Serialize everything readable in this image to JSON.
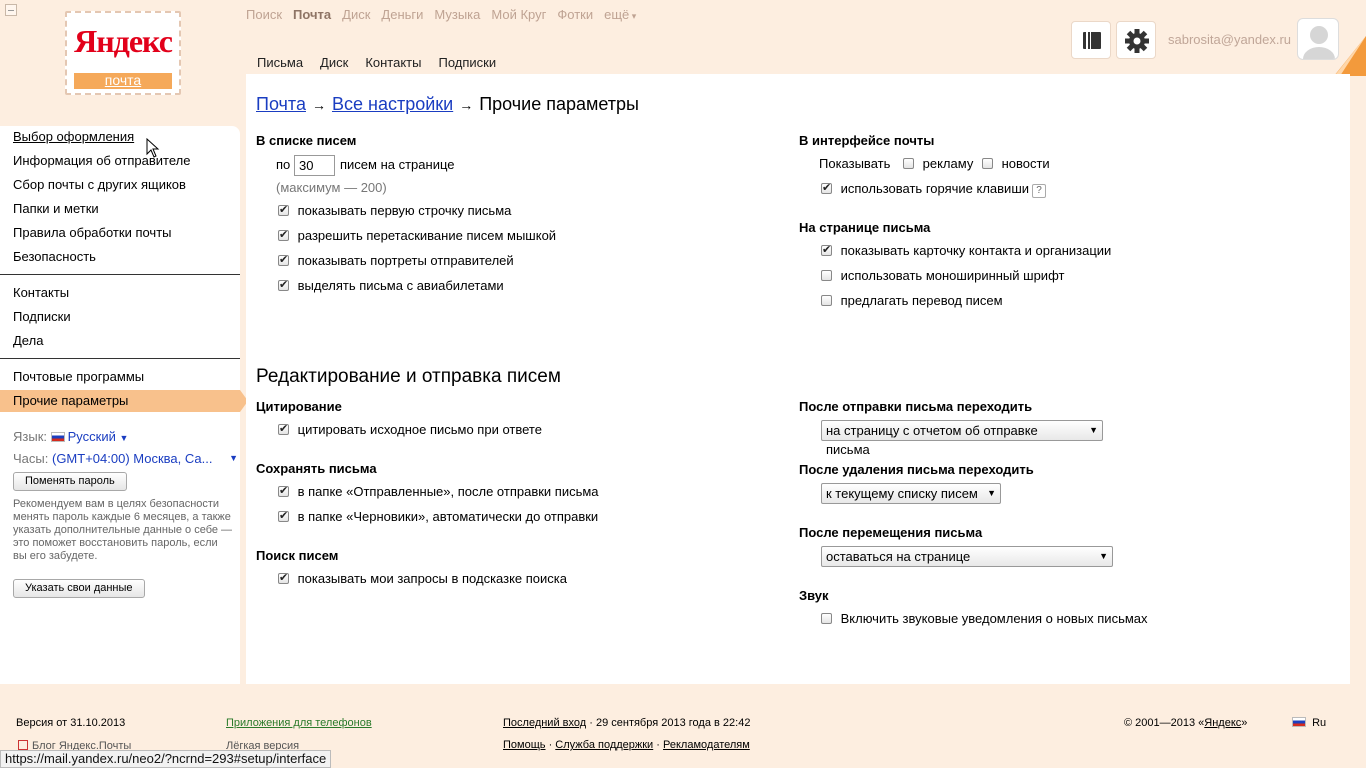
{
  "logo": {
    "brand": "Яндекс",
    "service": "почта"
  },
  "services": [
    {
      "label": "Поиск",
      "active": false
    },
    {
      "label": "Почта",
      "active": true
    },
    {
      "label": "Диск",
      "active": false
    },
    {
      "label": "Деньги",
      "active": false
    },
    {
      "label": "Музыка",
      "active": false
    },
    {
      "label": "Мой Круг",
      "active": false
    },
    {
      "label": "Фотки",
      "active": false
    },
    {
      "label": "ещё",
      "active": false
    }
  ],
  "subnav": [
    "Письма",
    "Диск",
    "Контакты",
    "Подписки"
  ],
  "header": {
    "user_email": "sabrosita@yandex.ru"
  },
  "sidebar": {
    "group1": [
      "Выбор оформления",
      "Информация об отправителе",
      "Сбор почты с других ящиков",
      "Папки и метки",
      "Правила обработки почты",
      "Безопасность"
    ],
    "group2": [
      "Контакты",
      "Подписки",
      "Дела"
    ],
    "group3": [
      "Почтовые программы",
      "Прочие параметры"
    ],
    "language_label": "Язык:",
    "language_value": "Русский",
    "clock_label": "Часы:",
    "clock_value": "(GMT+04:00) Москва, Са...",
    "change_password": "Поменять пароль",
    "note": "Рекомендуем вам в целях безопасности менять пароль каждые 6 месяцев, а также указать дополнительные данные о себе — это поможет восстановить пароль, если вы его забудете.",
    "provide_data": "Указать свои данные"
  },
  "breadcrumb": {
    "root": "Почта",
    "all": "Все настройки",
    "current": "Прочие параметры"
  },
  "list_section": {
    "title": "В списке писем",
    "per_page_prefix": "по",
    "per_page_value": "30",
    "per_page_suffix": "писем на странице",
    "max_note": "(максимум — 200)",
    "options": [
      {
        "label": "показывать первую строчку письма",
        "checked": true
      },
      {
        "label": "разрешить перетаскивание писем мышкой",
        "checked": true
      },
      {
        "label": "показывать портреты отправителей",
        "checked": true
      },
      {
        "label": "выделять письма с авиабилетами",
        "checked": true
      }
    ]
  },
  "interface_section": {
    "title": "В интерфейсе почты",
    "show_label": "Показывать",
    "ads": {
      "label": "рекламу",
      "checked": false
    },
    "news": {
      "label": "новости",
      "checked": false
    },
    "hotkeys": {
      "label": "использовать горячие клавиши",
      "checked": true
    },
    "help": "?"
  },
  "letter_page_section": {
    "title": "На странице письма",
    "options": [
      {
        "label": "показывать карточку контакта и организации",
        "checked": true
      },
      {
        "label": "использовать моноширинный шрифт",
        "checked": false
      },
      {
        "label": "предлагать перевод писем",
        "checked": false
      }
    ]
  },
  "edit_section": {
    "title": "Редактирование и отправка писем",
    "quote_title": "Цитирование",
    "quote_option": {
      "label": "цитировать исходное письмо при ответе",
      "checked": true
    },
    "save_title": "Сохранять письма",
    "save_options": [
      {
        "label": "в папке «Отправленные», после отправки письма",
        "checked": true
      },
      {
        "label": "в папке «Черновики», автоматически до отправки",
        "checked": true
      }
    ],
    "search_title": "Поиск писем",
    "search_option": {
      "label": "показывать мои запросы в подсказке поиска",
      "checked": true
    },
    "after_send_title": "После отправки письма переходить",
    "after_send_value": "на страницу с отчетом об отправке письма",
    "after_delete_title": "После удаления письма переходить",
    "after_delete_value": "к текущему списку писем",
    "after_move_title": "После перемещения письма",
    "after_move_value": "оставаться на странице",
    "sound_title": "Звук",
    "sound_option": {
      "label": "Включить звуковые уведомления о новых письмах",
      "checked": false
    }
  },
  "footer": {
    "version": "Версия от 31.10.2013",
    "apps": "Приложения для телефонов",
    "last_login_link": "Последний вход",
    "last_login_text": "· 29 сентября 2013 года в 22:42",
    "help": "Помощь",
    "support": "Служба поддержки",
    "advertisers": "Рекламодателям",
    "dot": "·",
    "copyright_prefix": "© 2001—2013 «",
    "copyright_link": "Яндекс",
    "copyright_suffix": "»",
    "lang": "Ru",
    "blog": "Блог Яндекс.Почты",
    "lite": "Лёгкая версия"
  },
  "status_url": "https://mail.yandex.ru/neo2/?ncrnd=293#setup/interface"
}
